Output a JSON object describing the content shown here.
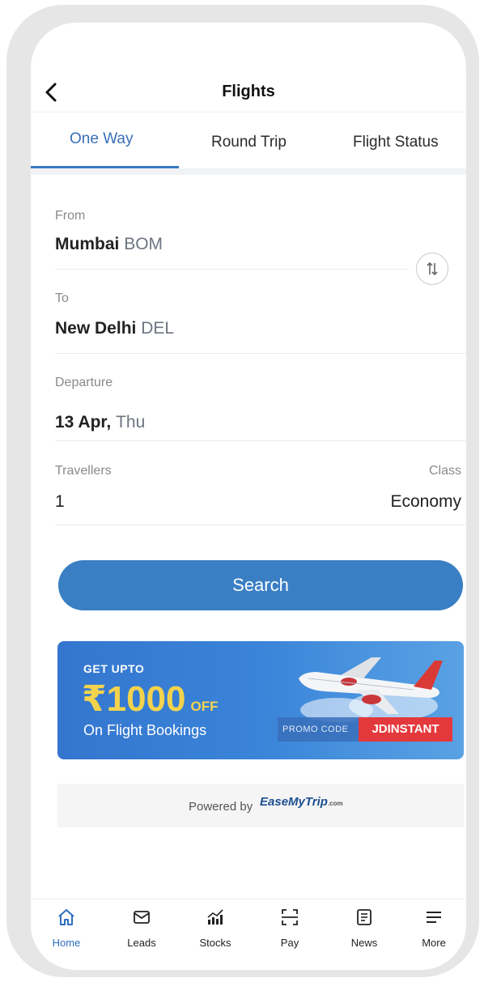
{
  "header": {
    "title": "Flights"
  },
  "tabs": [
    {
      "label": "One Way",
      "active": true
    },
    {
      "label": "Round Trip",
      "active": false
    },
    {
      "label": "Flight Status",
      "active": false
    }
  ],
  "form": {
    "from": {
      "label": "From",
      "city": "Mumbai",
      "code": "BOM"
    },
    "to": {
      "label": "To",
      "city": "New Delhi",
      "code": "DEL"
    },
    "departure": {
      "label": "Departure",
      "date": "13 Apr,",
      "day": "Thu"
    },
    "travellers": {
      "label": "Travellers",
      "value": "1"
    },
    "class": {
      "label": "Class",
      "value": "Economy"
    }
  },
  "search_label": "Search",
  "promo": {
    "get_upto": "GET UPTO",
    "amount": "₹1000",
    "off": "OFF",
    "subtitle": "On Flight Bookings",
    "promo_code_label": "PROMO CODE",
    "promo_code": "JDINSTANT"
  },
  "powered": {
    "label": "Powered by",
    "brand": "EaseMyTrip",
    "brand_suffix": ".com"
  },
  "bottom_nav": [
    {
      "label": "Home",
      "icon": "home-icon",
      "active": true
    },
    {
      "label": "Leads",
      "icon": "mail-icon"
    },
    {
      "label": "Stocks",
      "icon": "stocks-chart-icon"
    },
    {
      "label": "Pay",
      "icon": "scan-icon"
    },
    {
      "label": "News",
      "icon": "news-icon"
    },
    {
      "label": "More",
      "icon": "menu-icon"
    }
  ],
  "colors": {
    "accent": "#3a7fc4",
    "tab_active": "#3a6fb8",
    "promo_red": "#e4393c",
    "promo_yellow": "#f3d34d"
  }
}
